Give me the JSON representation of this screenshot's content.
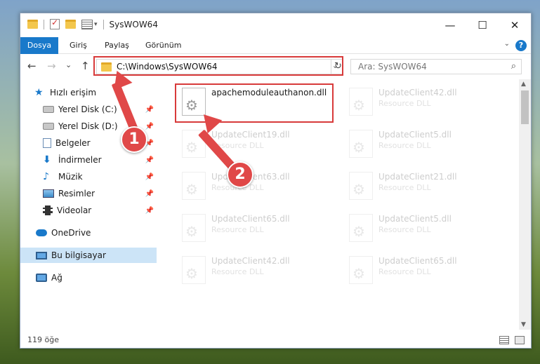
{
  "window": {
    "title": "SysWOW64",
    "minimize": "—",
    "maximize": "☐",
    "close": "✕"
  },
  "ribbon": {
    "tabs": [
      "Dosya",
      "Giriş",
      "Paylaş",
      "Görünüm"
    ],
    "help": "?"
  },
  "navigation": {
    "back": "←",
    "forward": "→",
    "recent": "⌄",
    "up": "↑",
    "address": "C:\\Windows\\SysWOW64",
    "address_dropdown": "⌄",
    "refresh": "↻",
    "search_placeholder": "Ara: SysWOW64",
    "search_icon": "⌕"
  },
  "sidebar": {
    "quick_access": "Hızlı erişim",
    "items": [
      {
        "label": "Yerel Disk (C:)",
        "icon": "disk-icon",
        "pinned": true
      },
      {
        "label": "Yerel Disk (D:)",
        "icon": "disk-icon",
        "pinned": true
      },
      {
        "label": "Belgeler",
        "icon": "documents-icon",
        "pinned": true
      },
      {
        "label": "İndirmeler",
        "icon": "downloads-icon",
        "pinned": true
      },
      {
        "label": "Müzik",
        "icon": "music-icon",
        "pinned": true
      },
      {
        "label": "Resimler",
        "icon": "pictures-icon",
        "pinned": true
      },
      {
        "label": "Videolar",
        "icon": "videos-icon",
        "pinned": true
      }
    ],
    "onedrive": "OneDrive",
    "this_pc": "Bu bilgisayar",
    "network": "Ağ"
  },
  "files": [
    {
      "name": "apachemoduleauthanon.dll",
      "type": "",
      "highlighted": true
    },
    {
      "name": "UpdateClient42.dll",
      "type": "Resource DLL"
    },
    {
      "name": "UpdateClient19.dll",
      "type": "Resource DLL"
    },
    {
      "name": "UpdateClient5.dll",
      "type": "Resource DLL"
    },
    {
      "name": "UpdateClient63.dll",
      "type": "Resource DLL"
    },
    {
      "name": "UpdateClient21.dll",
      "type": "Resource DLL"
    },
    {
      "name": "UpdateClient65.dll",
      "type": "Resource DLL"
    },
    {
      "name": "UpdateClient5.dll",
      "type": "Resource DLL"
    },
    {
      "name": "UpdateClient42.dll",
      "type": "Resource DLL"
    },
    {
      "name": "UpdateClient65.dll",
      "type": "Resource DLL"
    }
  ],
  "status": {
    "item_count": "119 öğe"
  },
  "annotations": {
    "step1": "1",
    "step2": "2",
    "color": "#e04848"
  }
}
